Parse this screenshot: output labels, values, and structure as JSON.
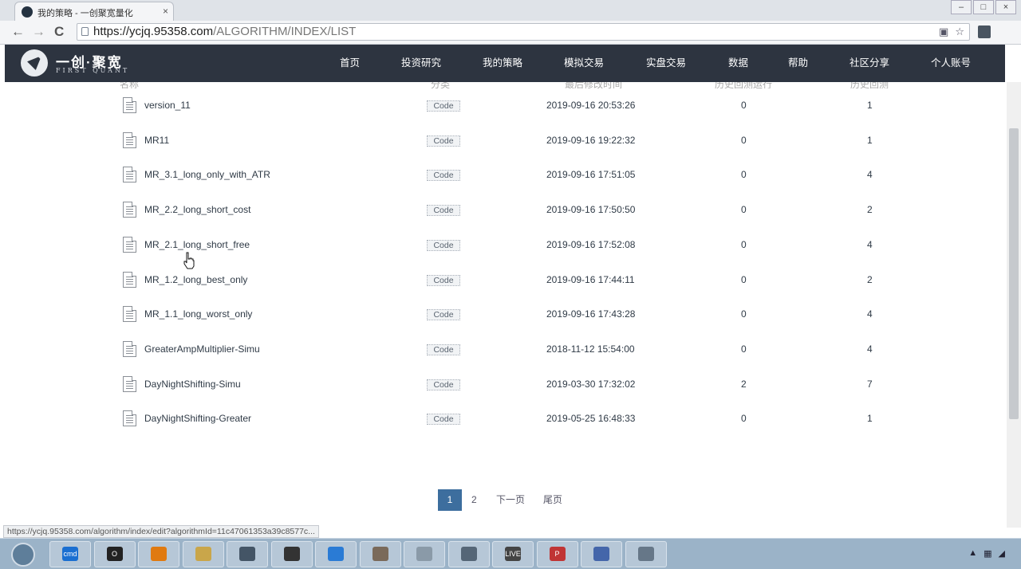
{
  "browser": {
    "tab_title": "我的策略 - 一创聚宽量化",
    "tab_close": "×",
    "window_buttons": [
      "–",
      "□",
      "×"
    ],
    "back_icon": "←",
    "forward_icon": "→",
    "reload_icon": "C",
    "url_scheme_host": "https://ycjq.95358.com",
    "url_path": "/ALGORITHM/INDEX/LIST",
    "star_icon": "☆"
  },
  "site": {
    "logo_cn": "一创·聚宽",
    "logo_en": "FIRST QUANT",
    "nav": [
      "首页",
      "投资研究",
      "我的策略",
      "模拟交易",
      "实盘交易",
      "数据",
      "帮助",
      "社区分享",
      "个人账号"
    ]
  },
  "table": {
    "headers": [
      "名称",
      "分类",
      "最后修改时间",
      "历史回测运行",
      "历史回测"
    ],
    "rows": [
      {
        "name": "version_11",
        "tag": "Code",
        "time": "2019-09-16 20:53:26",
        "a": "0",
        "b": "1"
      },
      {
        "name": "MR11",
        "tag": "Code",
        "time": "2019-09-16 19:22:32",
        "a": "0",
        "b": "1"
      },
      {
        "name": "MR_3.1_long_only_with_ATR",
        "tag": "Code",
        "time": "2019-09-16 17:51:05",
        "a": "0",
        "b": "4"
      },
      {
        "name": "MR_2.2_long_short_cost",
        "tag": "Code",
        "time": "2019-09-16 17:50:50",
        "a": "0",
        "b": "2"
      },
      {
        "name": "MR_2.1_long_short_free",
        "tag": "Code",
        "time": "2019-09-16 17:52:08",
        "a": "0",
        "b": "4"
      },
      {
        "name": "MR_1.2_long_best_only",
        "tag": "Code",
        "time": "2019-09-16 17:44:11",
        "a": "0",
        "b": "2"
      },
      {
        "name": "MR_1.1_long_worst_only",
        "tag": "Code",
        "time": "2019-09-16 17:43:28",
        "a": "0",
        "b": "4"
      },
      {
        "name": "GreaterAmpMultiplier-Simu",
        "tag": "Code",
        "time": "2018-11-12 15:54:00",
        "a": "0",
        "b": "4"
      },
      {
        "name": "DayNightShifting-Simu",
        "tag": "Code",
        "time": "2019-03-30 17:32:02",
        "a": "2",
        "b": "7"
      },
      {
        "name": "DayNightShifting-Greater",
        "tag": "Code",
        "time": "2019-05-25 16:48:33",
        "a": "0",
        "b": "1"
      }
    ]
  },
  "pagination": {
    "current": "1",
    "page2": "2",
    "next": "下一页",
    "last": "尾页"
  },
  "status_url": "https://ycjq.95358.com/algorithm/index/edit?algorithmId=11c47061353a39c8577c...",
  "taskbar": {
    "items": [
      "cmd",
      "O",
      "",
      "",
      "",
      "",
      "",
      "",
      "",
      "",
      "LIVE",
      "P",
      "",
      ""
    ]
  },
  "icons": {
    "colors": {
      "header_bg": "#2d3440",
      "page_active": "#3d6e9e",
      "taskbar": "#9bb3c8"
    }
  }
}
